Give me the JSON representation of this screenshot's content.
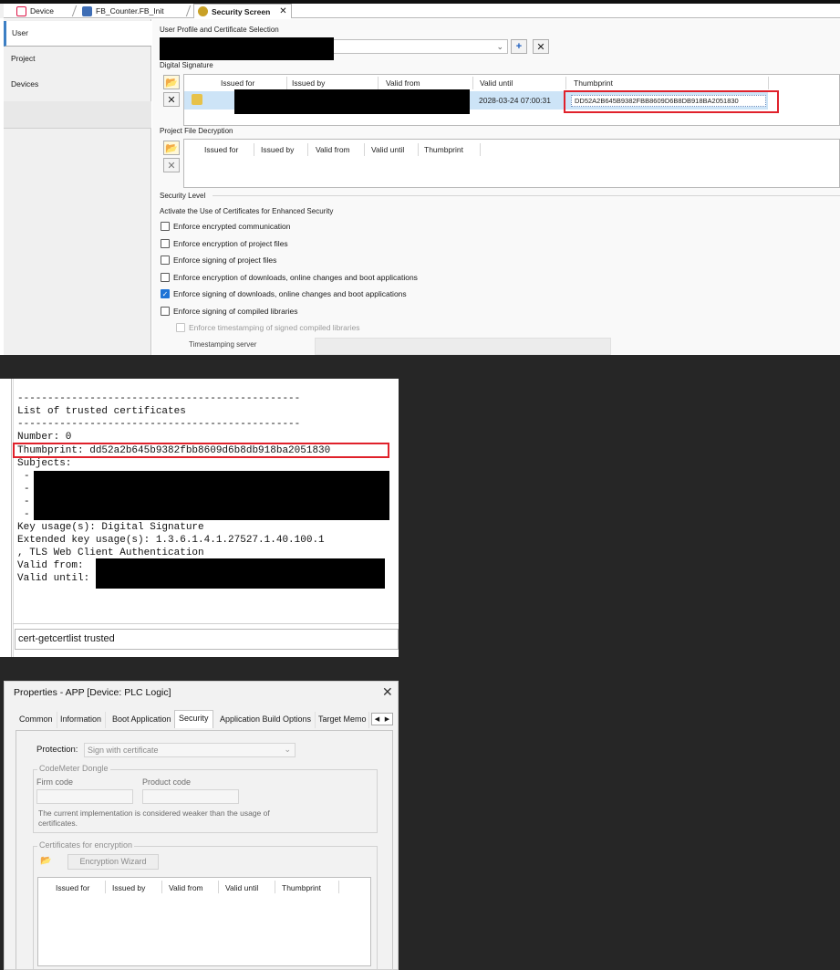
{
  "security_screen": {
    "tabs": [
      {
        "label": "Device"
      },
      {
        "label": "FB_Counter.FB_Init"
      },
      {
        "label": "Security Screen"
      }
    ],
    "side_nav": [
      "User",
      "Project",
      "Devices"
    ],
    "user_profile_label": "User Profile and Certificate Selection",
    "digital_signature": {
      "label": "Digital Signature",
      "columns": [
        "Issued for",
        "Issued by",
        "Valid from",
        "Valid until",
        "Thumbprint"
      ],
      "row": {
        "valid_until": "2028-03-24 07:00:31",
        "thumbprint": "DD52A2B645B9382FBB8609D6B8DB918BA2051830"
      }
    },
    "project_file_decryption": {
      "label": "Project File Decryption",
      "columns": [
        "Issued for",
        "Issued by",
        "Valid from",
        "Valid until",
        "Thumbprint"
      ]
    },
    "security_level": {
      "label": "Security Level",
      "subtitle": "Activate the Use of Certificates for Enhanced Security",
      "options": [
        {
          "label": "Enforce encrypted communication",
          "checked": false
        },
        {
          "label": "Enforce encryption of project files",
          "checked": false
        },
        {
          "label": "Enforce signing of project files",
          "checked": false
        },
        {
          "label": "Enforce encryption of downloads, online changes and boot applications",
          "checked": false
        },
        {
          "label": "Enforce signing of downloads, online changes and boot applications",
          "checked": true
        },
        {
          "label": "Enforce signing of compiled libraries",
          "checked": false
        }
      ],
      "sub_option": {
        "label": "Enforce timestamping of signed compiled libraries",
        "checked": false,
        "enabled": false
      },
      "timestamping_server_label": "Timestamping server"
    },
    "icons": {
      "add": "plus-icon",
      "remove": "x-icon"
    }
  },
  "console": {
    "separator": "-----------------------------------------------",
    "heading": "List of trusted certificates",
    "number_line": "Number: 0",
    "thumbprint_line": "Thumbprint: dd52a2b645b9382fbb8609d6b8db918ba2051830",
    "subjects_label": "Subjects:",
    "subject_dashes": [
      "-",
      "-",
      "-",
      "-"
    ],
    "key_usage": "Key usage(s): Digital Signature",
    "ext_key_usage_1": "Extended key usage(s): 1.3.6.1.4.1.27527.1.40.100.1",
    "ext_key_usage_2": ", TLS Web Client Authentication",
    "valid_from_label": "Valid from:",
    "valid_until_label": "Valid until:",
    "command": "cert-getcertlist trusted"
  },
  "properties": {
    "title": "Properties - APP [Device: PLC Logic]",
    "tabs": [
      "Common",
      "Information",
      "Boot Application",
      "Security",
      "Application Build Options",
      "Target Memo"
    ],
    "selected_tab": "Security",
    "protection_label": "Protection:",
    "protection_value": "Sign with certificate",
    "codemeter": {
      "title": "CodeMeter Dongle",
      "firm_code_label": "Firm code",
      "product_code_label": "Product code",
      "note": "The current implementation is considered weaker than the usage of certificates."
    },
    "certs_encryption": {
      "title": "Certificates for encryption",
      "wizard_button": "Encryption Wizard",
      "columns": [
        "Issued for",
        "Issued by",
        "Valid from",
        "Valid until",
        "Thumbprint"
      ]
    }
  },
  "colors": {
    "background": "#262626",
    "highlight_red": "#e0212b",
    "selection_blue": "#cde4f7",
    "check_blue": "#1e73d6"
  }
}
